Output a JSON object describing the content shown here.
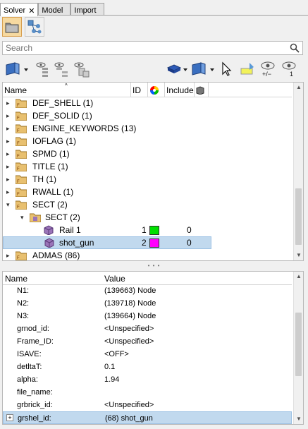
{
  "tabs": [
    {
      "label": "Solver",
      "close": "✕"
    },
    {
      "label": "Model"
    },
    {
      "label": "Import"
    }
  ],
  "search": {
    "placeholder": "Search"
  },
  "tree": {
    "columns": {
      "name": "Name",
      "id": "ID",
      "include": "Include"
    },
    "rows": [
      {
        "label": "DEF_SHELL  (1)"
      },
      {
        "label": "DEF_SOLID  (1)"
      },
      {
        "label": "ENGINE_KEYWORDS  (13)"
      },
      {
        "label": "IOFLAG  (1)"
      },
      {
        "label": "SPMD  (1)"
      },
      {
        "label": "TITLE  (1)"
      },
      {
        "label": "TH  (1)"
      },
      {
        "label": "RWALL  (1)"
      },
      {
        "label": "SECT  (2)"
      },
      {
        "label": "SECT  (2)"
      },
      {
        "label": "Rail 1",
        "id": "1",
        "color": "#00e000",
        "include": "0"
      },
      {
        "label": "shot_gun",
        "id": "2",
        "color": "#ff00ff",
        "include": "0"
      },
      {
        "label": "ADMAS  (86)"
      }
    ]
  },
  "props": {
    "columns": {
      "name": "Name",
      "value": "Value"
    },
    "rows": [
      {
        "name": "N1:",
        "value": "(139663) Node"
      },
      {
        "name": "N2:",
        "value": "(139718) Node"
      },
      {
        "name": "N3:",
        "value": "(139664) Node"
      },
      {
        "name": "grnod_id:",
        "value": "<Unspecified>"
      },
      {
        "name": "Frame_ID:",
        "value": "<Unspecified>"
      },
      {
        "name": "ISAVE:",
        "value": "<OFF>"
      },
      {
        "name": "detltaT:",
        "value": "0.1"
      },
      {
        "name": "alpha:",
        "value": "1.94"
      },
      {
        "name": "file_name:",
        "value": ""
      },
      {
        "name": "grbrick_id:",
        "value": "<Unspecified>"
      },
      {
        "name": "grshel_id:",
        "value": "(68) shot_gun",
        "expand": "+"
      }
    ]
  },
  "colors": {
    "selection": "#c1d9ee",
    "accent": "#f6d9a0"
  },
  "icons": [
    "close-icon",
    "folder-icon",
    "network-icon",
    "search-icon",
    "cube-icon",
    "eye-icon",
    "cursor-icon"
  ]
}
